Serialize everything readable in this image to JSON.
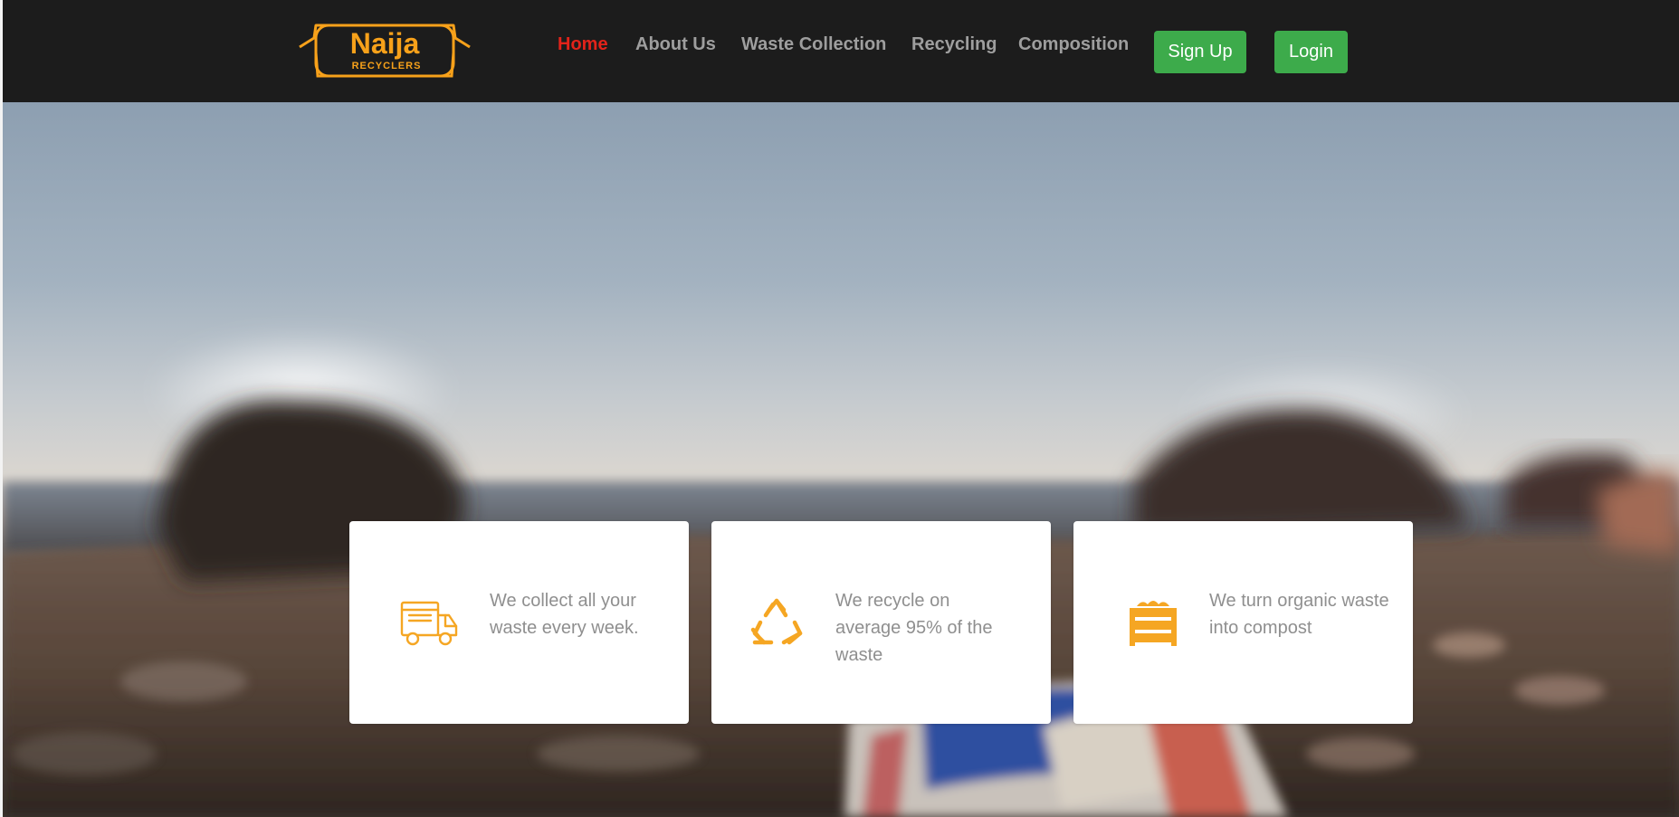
{
  "brand": {
    "logo_primary": "Naija",
    "logo_secondary": "RECYCLERS",
    "logo_color": "#f7a11a"
  },
  "nav": {
    "items": [
      {
        "label": "Home",
        "active": true
      },
      {
        "label": "About Us",
        "active": false
      },
      {
        "label": "Waste Collection",
        "active": false
      },
      {
        "label": "Recycling",
        "active": false
      },
      {
        "label": "Composition",
        "active": false
      }
    ],
    "signup_label": "Sign Up",
    "login_label": "Login"
  },
  "features": [
    {
      "icon": "truck-icon",
      "text": "We collect all your waste every week."
    },
    {
      "icon": "recycle-icon",
      "text": "We recycle on average 95% of the waste"
    },
    {
      "icon": "compost-icon",
      "text": "We turn organic waste into compost"
    }
  ],
  "colors": {
    "header_bg": "#1c1c1c",
    "nav_text": "#9e9e9e",
    "nav_active": "#e2231a",
    "button_green": "#3dab4b",
    "icon_orange": "#f5a623",
    "card_text": "#8f8f8f"
  }
}
